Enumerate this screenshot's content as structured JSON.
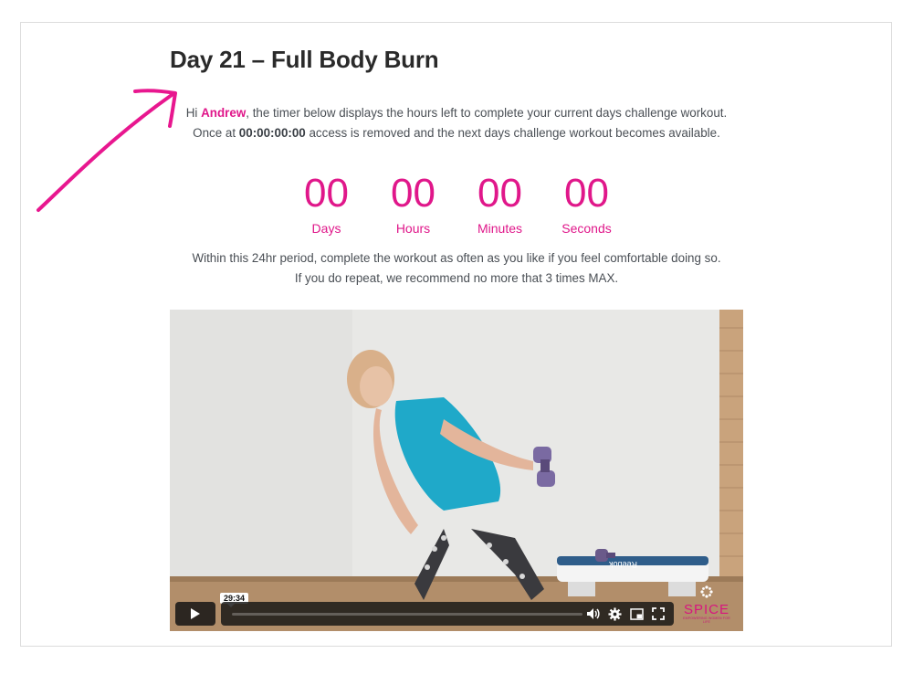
{
  "page": {
    "title": "Day 21 – Full Body Burn",
    "intro": {
      "greeting": "Hi ",
      "name": "Andrew",
      "line1_rest": ", the timer below displays the hours left to complete your current days challenge workout.",
      "line2_prefix": "Once at ",
      "zero_time": "00:00:00:00",
      "line2_rest": " access is removed and the next days challenge workout becomes available."
    },
    "countdown": [
      {
        "value": "00",
        "label": "Days"
      },
      {
        "value": "00",
        "label": "Hours"
      },
      {
        "value": "00",
        "label": "Minutes"
      },
      {
        "value": "00",
        "label": "Seconds"
      }
    ],
    "note": {
      "line1": "Within this 24hr period, complete the workout as often as you like if you feel comfortable doing so.",
      "line2": "If you do repeat, we recommend no more that 3 times MAX."
    }
  },
  "video": {
    "duration": "29:34",
    "progress": 0.0,
    "logo_text": "SPICE",
    "logo_tagline": "EMPOWERING WOMEN FOR LIFE",
    "step_text": "Reebok"
  },
  "colors": {
    "accent": "#e0178a",
    "text": "#4a4f55",
    "title": "#2a2a2a"
  },
  "icons": [
    "play-icon",
    "volume-icon",
    "settings-icon",
    "pip-icon",
    "fullscreen-icon",
    "arrow-annotation-icon"
  ]
}
